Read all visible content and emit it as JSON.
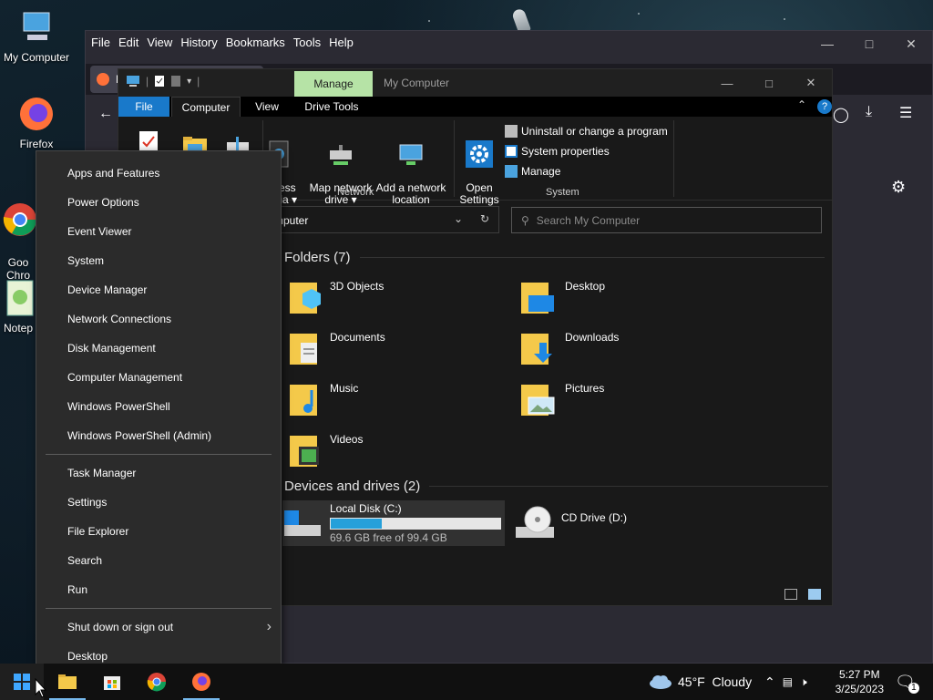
{
  "desktop": {
    "icons": [
      {
        "label": "My Computer"
      },
      {
        "label": "Firefox"
      },
      {
        "label": "Goo\nChro"
      },
      {
        "label": "Notep"
      }
    ]
  },
  "firefox": {
    "menu": [
      "File",
      "Edit",
      "View",
      "History",
      "Bookmarks",
      "Tools",
      "Help"
    ],
    "tab_label": "M"
  },
  "explorer": {
    "manage_tab": "Manage",
    "title": "My Computer",
    "ribbon_tabs": [
      "File",
      "Computer",
      "View",
      "Drive Tools"
    ],
    "ribbon": {
      "access_media": "ccess\nedia ▾",
      "map_network_drive": "Map network\ndrive ▾",
      "add_network_location": "Add a network\nlocation",
      "open_settings": "Open\nSettings",
      "uninstall": "Uninstall or change a program",
      "system_properties": "System properties",
      "manage": "Manage",
      "group_network": "Network",
      "group_system": "System"
    },
    "address": "mputer",
    "search_placeholder": "Search My Computer",
    "folders_heading": "Folders (7)",
    "folders": [
      "3D Objects",
      "Desktop",
      "Documents",
      "Downloads",
      "Music",
      "Pictures",
      "Videos"
    ],
    "devices_heading": "Devices and drives (2)",
    "drives": [
      {
        "name": "Local Disk (C:)",
        "free": "69.6 GB free of 99.4 GB",
        "used_fraction": 0.3
      },
      {
        "name": "CD Drive (D:)"
      }
    ]
  },
  "winx_menu": {
    "group1": [
      "Apps and Features",
      "Power Options",
      "Event Viewer",
      "System",
      "Device Manager",
      "Network Connections",
      "Disk Management",
      "Computer Management",
      "Windows PowerShell",
      "Windows PowerShell (Admin)"
    ],
    "group2": [
      "Task Manager",
      "Settings",
      "File Explorer",
      "Search",
      "Run"
    ],
    "group3": [
      "Shut down or sign out",
      "Desktop"
    ]
  },
  "taskbar": {
    "weather": "45°F  Cloudy",
    "time": "5:27 PM",
    "date": "3/25/2023",
    "notifications": "1"
  },
  "colors": {
    "accent": "#1979ca",
    "manage_tab": "#b6e3a6",
    "drive_bar": "#26a0da"
  }
}
